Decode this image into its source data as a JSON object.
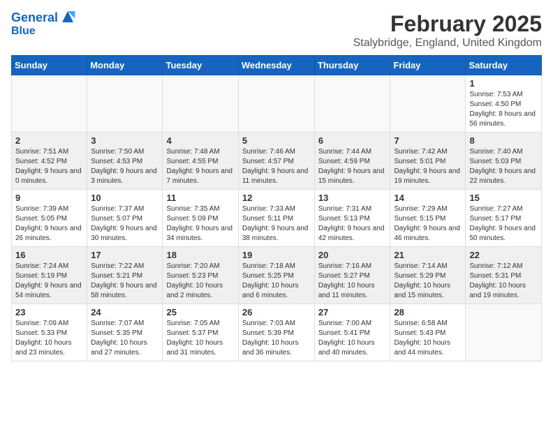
{
  "logo": {
    "line1": "General",
    "line2": "Blue"
  },
  "title": "February 2025",
  "location": "Stalybridge, England, United Kingdom",
  "days_of_week": [
    "Sunday",
    "Monday",
    "Tuesday",
    "Wednesday",
    "Thursday",
    "Friday",
    "Saturday"
  ],
  "weeks": [
    [
      {
        "day": "",
        "info": ""
      },
      {
        "day": "",
        "info": ""
      },
      {
        "day": "",
        "info": ""
      },
      {
        "day": "",
        "info": ""
      },
      {
        "day": "",
        "info": ""
      },
      {
        "day": "",
        "info": ""
      },
      {
        "day": "1",
        "info": "Sunrise: 7:53 AM\nSunset: 4:50 PM\nDaylight: 8 hours and 56 minutes."
      }
    ],
    [
      {
        "day": "2",
        "info": "Sunrise: 7:51 AM\nSunset: 4:52 PM\nDaylight: 9 hours and 0 minutes."
      },
      {
        "day": "3",
        "info": "Sunrise: 7:50 AM\nSunset: 4:53 PM\nDaylight: 9 hours and 3 minutes."
      },
      {
        "day": "4",
        "info": "Sunrise: 7:48 AM\nSunset: 4:55 PM\nDaylight: 9 hours and 7 minutes."
      },
      {
        "day": "5",
        "info": "Sunrise: 7:46 AM\nSunset: 4:57 PM\nDaylight: 9 hours and 11 minutes."
      },
      {
        "day": "6",
        "info": "Sunrise: 7:44 AM\nSunset: 4:59 PM\nDaylight: 9 hours and 15 minutes."
      },
      {
        "day": "7",
        "info": "Sunrise: 7:42 AM\nSunset: 5:01 PM\nDaylight: 9 hours and 19 minutes."
      },
      {
        "day": "8",
        "info": "Sunrise: 7:40 AM\nSunset: 5:03 PM\nDaylight: 9 hours and 22 minutes."
      }
    ],
    [
      {
        "day": "9",
        "info": "Sunrise: 7:39 AM\nSunset: 5:05 PM\nDaylight: 9 hours and 26 minutes."
      },
      {
        "day": "10",
        "info": "Sunrise: 7:37 AM\nSunset: 5:07 PM\nDaylight: 9 hours and 30 minutes."
      },
      {
        "day": "11",
        "info": "Sunrise: 7:35 AM\nSunset: 5:09 PM\nDaylight: 9 hours and 34 minutes."
      },
      {
        "day": "12",
        "info": "Sunrise: 7:33 AM\nSunset: 5:11 PM\nDaylight: 9 hours and 38 minutes."
      },
      {
        "day": "13",
        "info": "Sunrise: 7:31 AM\nSunset: 5:13 PM\nDaylight: 9 hours and 42 minutes."
      },
      {
        "day": "14",
        "info": "Sunrise: 7:29 AM\nSunset: 5:15 PM\nDaylight: 9 hours and 46 minutes."
      },
      {
        "day": "15",
        "info": "Sunrise: 7:27 AM\nSunset: 5:17 PM\nDaylight: 9 hours and 50 minutes."
      }
    ],
    [
      {
        "day": "16",
        "info": "Sunrise: 7:24 AM\nSunset: 5:19 PM\nDaylight: 9 hours and 54 minutes."
      },
      {
        "day": "17",
        "info": "Sunrise: 7:22 AM\nSunset: 5:21 PM\nDaylight: 9 hours and 58 minutes."
      },
      {
        "day": "18",
        "info": "Sunrise: 7:20 AM\nSunset: 5:23 PM\nDaylight: 10 hours and 2 minutes."
      },
      {
        "day": "19",
        "info": "Sunrise: 7:18 AM\nSunset: 5:25 PM\nDaylight: 10 hours and 6 minutes."
      },
      {
        "day": "20",
        "info": "Sunrise: 7:16 AM\nSunset: 5:27 PM\nDaylight: 10 hours and 11 minutes."
      },
      {
        "day": "21",
        "info": "Sunrise: 7:14 AM\nSunset: 5:29 PM\nDaylight: 10 hours and 15 minutes."
      },
      {
        "day": "22",
        "info": "Sunrise: 7:12 AM\nSunset: 5:31 PM\nDaylight: 10 hours and 19 minutes."
      }
    ],
    [
      {
        "day": "23",
        "info": "Sunrise: 7:09 AM\nSunset: 5:33 PM\nDaylight: 10 hours and 23 minutes."
      },
      {
        "day": "24",
        "info": "Sunrise: 7:07 AM\nSunset: 5:35 PM\nDaylight: 10 hours and 27 minutes."
      },
      {
        "day": "25",
        "info": "Sunrise: 7:05 AM\nSunset: 5:37 PM\nDaylight: 10 hours and 31 minutes."
      },
      {
        "day": "26",
        "info": "Sunrise: 7:03 AM\nSunset: 5:39 PM\nDaylight: 10 hours and 36 minutes."
      },
      {
        "day": "27",
        "info": "Sunrise: 7:00 AM\nSunset: 5:41 PM\nDaylight: 10 hours and 40 minutes."
      },
      {
        "day": "28",
        "info": "Sunrise: 6:58 AM\nSunset: 5:43 PM\nDaylight: 10 hours and 44 minutes."
      },
      {
        "day": "",
        "info": ""
      }
    ]
  ]
}
